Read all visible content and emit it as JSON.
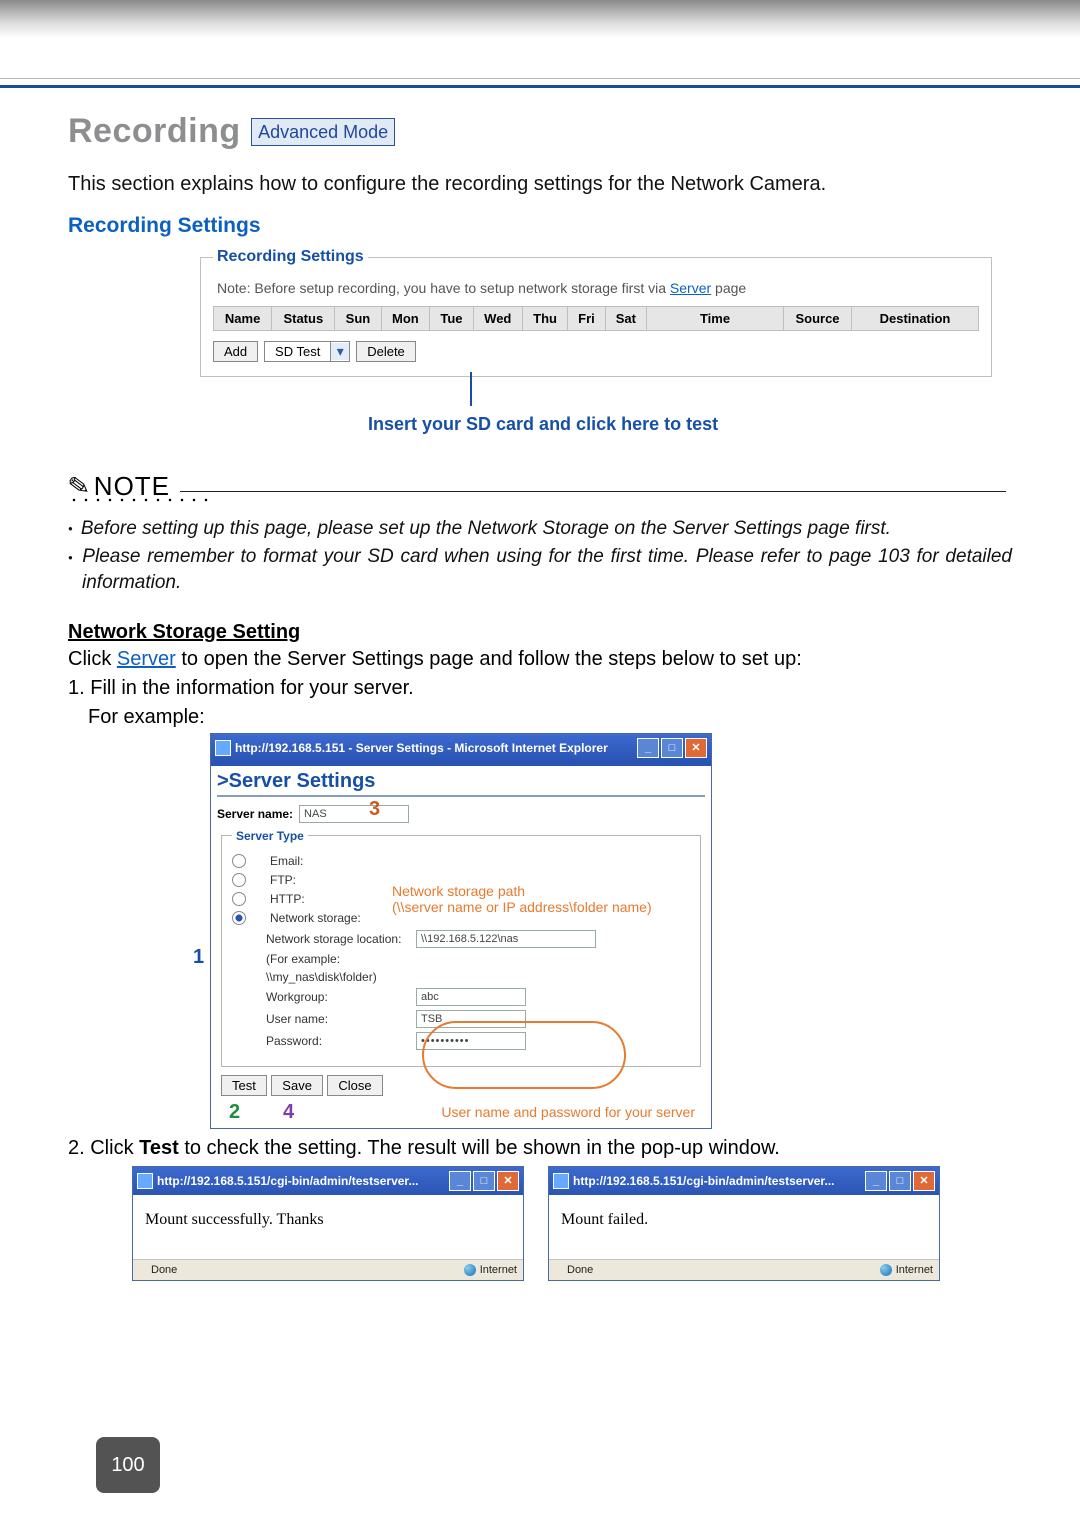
{
  "header": {
    "title": "Recording",
    "mode_badge": "Advanced Mode",
    "intro": "This section explains how to configure the recording settings for the Network Camera.",
    "subhead": "Recording Settings"
  },
  "rec_panel": {
    "legend": "Recording Settings",
    "note_pre": "Note: Before setup recording, you have to setup network storage first via ",
    "note_link": "Server",
    "note_post": " page",
    "cols": [
      "Name",
      "Status",
      "Sun",
      "Mon",
      "Tue",
      "Wed",
      "Thu",
      "Fri",
      "Sat",
      "Time",
      "Source",
      "Destination"
    ],
    "add_btn": "Add",
    "del_btn": "Delete",
    "combo_value": "SD Test",
    "hint": "Insert your SD card and click here to test"
  },
  "note_block": {
    "label": "NOTE",
    "items": [
      "Before setting up this page, please set up the Network Storage on the Server Settings page first.",
      "Please remember to format your SD card when using for the first time. Please refer to page 103 for detailed information."
    ]
  },
  "nss": {
    "heading": "Network Storage Setting",
    "line1a": "Click ",
    "line1_link": "Server",
    "line1b": " to open the Server Settings page and follow the steps below to set up:",
    "step1": "1. Fill in the information for your server.",
    "for_example": "For example:",
    "step2_pre": "2. Click ",
    "step2_bold": "Test",
    "step2_post": " to check the setting. The result will be shown in the pop-up window."
  },
  "server_win": {
    "title": "http://192.168.5.151 - Server Settings - Microsoft Internet Explorer",
    "page_head": ">Server Settings",
    "server_name_label": "Server name:",
    "server_name_value": "NAS",
    "type_legend": "Server Type",
    "opt_email": "Email:",
    "opt_ftp": "FTP:",
    "opt_http": "HTTP:",
    "opt_ns": "Network storage:",
    "ns_loc_label": "Network storage location:",
    "ns_loc_value": "\\\\192.168.5.122\\nas",
    "ns_example": "(For example:",
    "ns_example2": "\\\\my_nas\\disk\\folder)",
    "wg_label": "Workgroup:",
    "wg_value": "abc",
    "user_label": "User name:",
    "user_value": "TSB",
    "pass_label": "Password:",
    "pass_value": "••••••••••",
    "btn_test": "Test",
    "btn_save": "Save",
    "btn_close": "Close",
    "call_path_a": "Network storage path",
    "call_path_b": "(\\\\server name or IP address\\folder name)",
    "call_cred": "User name and password for your server"
  },
  "markers": {
    "m1": "1",
    "m2": "2",
    "m3": "3",
    "m4": "4"
  },
  "popup": {
    "title": "http://192.168.5.151/cgi-bin/admin/testserver...",
    "ok": "Mount successfully. Thanks",
    "fail": "Mount failed.",
    "done": "Done",
    "zone": "Internet"
  },
  "page_number": "100"
}
